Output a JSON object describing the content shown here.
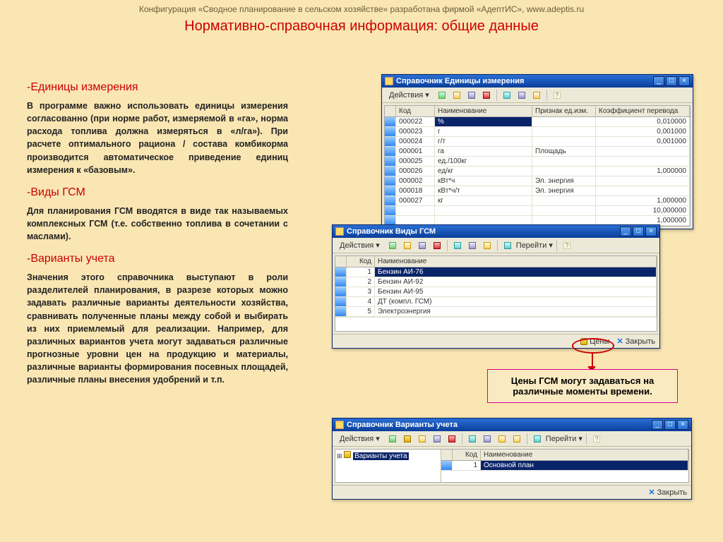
{
  "header_line": "Конфигурация «Сводное планирование в сельском хозяйстве» разработана фирмой «АдептИС», www.adeptis.ru",
  "page_title": "Нормативно-справочная информация: общие данные",
  "sections": {
    "s1_title": "-Единицы измерения",
    "s1_body": "В программе важно использовать единицы измерения согласованно (при норме работ, измеряемой в «га», норма расхода топлива должна измеряться в «л/га»). При расчете оптимального рациона / состава комбикорма производится автоматическое приведение единиц измерения к «базовым».",
    "s2_title": "-Виды ГСМ",
    "s2_body": "Для планирования ГСМ вводятся в виде так называемых комплексных ГСМ (т.е. собственно топлива в сочетании с маслами).",
    "s3_title": "-Варианты учета",
    "s3_body": "Значения этого справочника выступают в роли разделителей планирования, в разрезе которых можно задавать различные варианты деятельности хозяйства, сравнивать полученные планы между собой и выбирать из них приемлемый для реализации. Например, для различных вариантов учета могут задаваться различные прогнозные уровни цен на продукцию и материалы, различные варианты формирования посевных площадей, различные планы внесения удобрений и т.п."
  },
  "common": {
    "actions": "Действия ▾",
    "goto": "Перейти ▾",
    "close": "Закрыть",
    "prices": "Цены",
    "help": "?"
  },
  "win1": {
    "title": "Справочник Единицы измерения",
    "cols": {
      "code": "Код",
      "name": "Наименование",
      "sign": "Признак ед.изм.",
      "coef": "Коэффициент перевода"
    },
    "rows": [
      {
        "code": "000022",
        "name": "%",
        "sign": "",
        "coef": "0,010000"
      },
      {
        "code": "000023",
        "name": "г",
        "sign": "",
        "coef": "0,001000"
      },
      {
        "code": "000024",
        "name": "г/т",
        "sign": "",
        "coef": "0,001000"
      },
      {
        "code": "000001",
        "name": "га",
        "sign": "Площадь",
        "coef": ""
      },
      {
        "code": "000025",
        "name": "ед./100кг",
        "sign": "",
        "coef": ""
      },
      {
        "code": "000026",
        "name": "ед/кг",
        "sign": "",
        "coef": "1,000000"
      },
      {
        "code": "000002",
        "name": "кВт*ч",
        "sign": "Эл. энергия",
        "coef": ""
      },
      {
        "code": "000018",
        "name": "кВт*ч/т",
        "sign": "Эл. энергия",
        "coef": ""
      },
      {
        "code": "000027",
        "name": "кг",
        "sign": "",
        "coef": "1,000000"
      },
      {
        "code": "",
        "name": "",
        "sign": "",
        "coef": "10,000000"
      },
      {
        "code": "",
        "name": "",
        "sign": "",
        "coef": "1,000000"
      }
    ]
  },
  "win2": {
    "title": "Справочник Виды ГСМ",
    "cols": {
      "code": "Код",
      "name": "Наименование"
    },
    "rows": [
      {
        "code": "1",
        "name": "Бензин АИ-76",
        "sel": true
      },
      {
        "code": "2",
        "name": "Бензин АИ-92"
      },
      {
        "code": "3",
        "name": "Бензин АИ-95"
      },
      {
        "code": "4",
        "name": "ДТ (компл. ГСМ)"
      },
      {
        "code": "5",
        "name": "Электроэнергия"
      }
    ]
  },
  "win3": {
    "title": "Справочник Варианты учета",
    "tree_root": "Варианты учета",
    "cols": {
      "code": "Код",
      "name": "Наименование"
    },
    "rows": [
      {
        "code": "1",
        "name": "Основной план",
        "sel": true
      }
    ]
  },
  "callout": "Цены ГСМ могут задаваться на различные моменты времени."
}
